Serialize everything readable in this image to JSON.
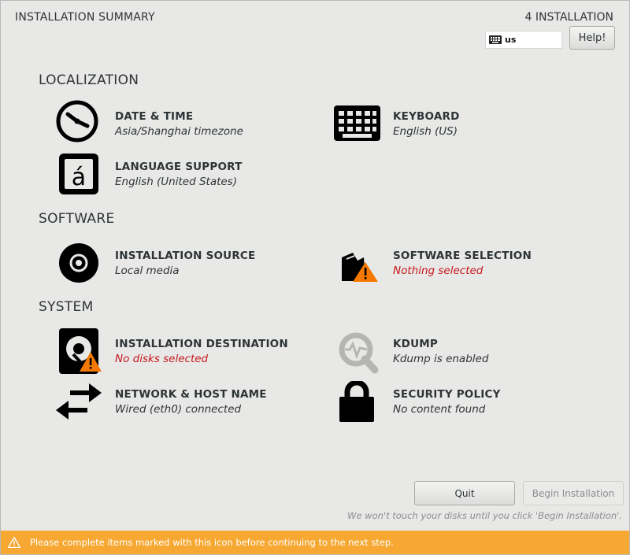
{
  "header": {
    "title": "INSTALLATION SUMMARY",
    "product": "4 INSTALLATION",
    "keyboard_layout": "us",
    "help_label": "Help!"
  },
  "sections": {
    "localization": "LOCALIZATION",
    "software": "SOFTWARE",
    "system": "SYSTEM"
  },
  "spokes": {
    "datetime": {
      "title": "DATE & TIME",
      "status": "Asia/Shanghai timezone",
      "icon": "clock-icon"
    },
    "keyboard": {
      "title": "KEYBOARD",
      "status": "English (US)",
      "icon": "keyboard-icon"
    },
    "language": {
      "title": "LANGUAGE SUPPORT",
      "status": "English (United States)",
      "icon": "language-icon"
    },
    "source": {
      "title": "INSTALLATION SOURCE",
      "status": "Local media",
      "icon": "disc-icon"
    },
    "software": {
      "title": "SOFTWARE SELECTION",
      "status": "Nothing selected",
      "icon": "package-warning-icon"
    },
    "destination": {
      "title": "INSTALLATION DESTINATION",
      "status": "No disks selected",
      "icon": "harddisk-warning-icon"
    },
    "kdump": {
      "title": "KDUMP",
      "status": "Kdump is enabled",
      "icon": "kdump-magnifier-icon"
    },
    "network": {
      "title": "NETWORK & HOST NAME",
      "status": "Wired (eth0) connected",
      "icon": "network-arrows-icon"
    },
    "security": {
      "title": "SECURITY POLICY",
      "status": "No content found",
      "icon": "lock-icon"
    }
  },
  "footer": {
    "quit_label": "Quit",
    "begin_label": "Begin Installation",
    "note": "We won't touch your disks until you click 'Begin Installation'.",
    "warning": "Please complete items marked with this icon before continuing to the next step."
  },
  "colors": {
    "background": "#e8e8e7",
    "warning_bar": "#f6a833",
    "warning_text": "#c8181d",
    "warning_icon": "#f57900"
  }
}
